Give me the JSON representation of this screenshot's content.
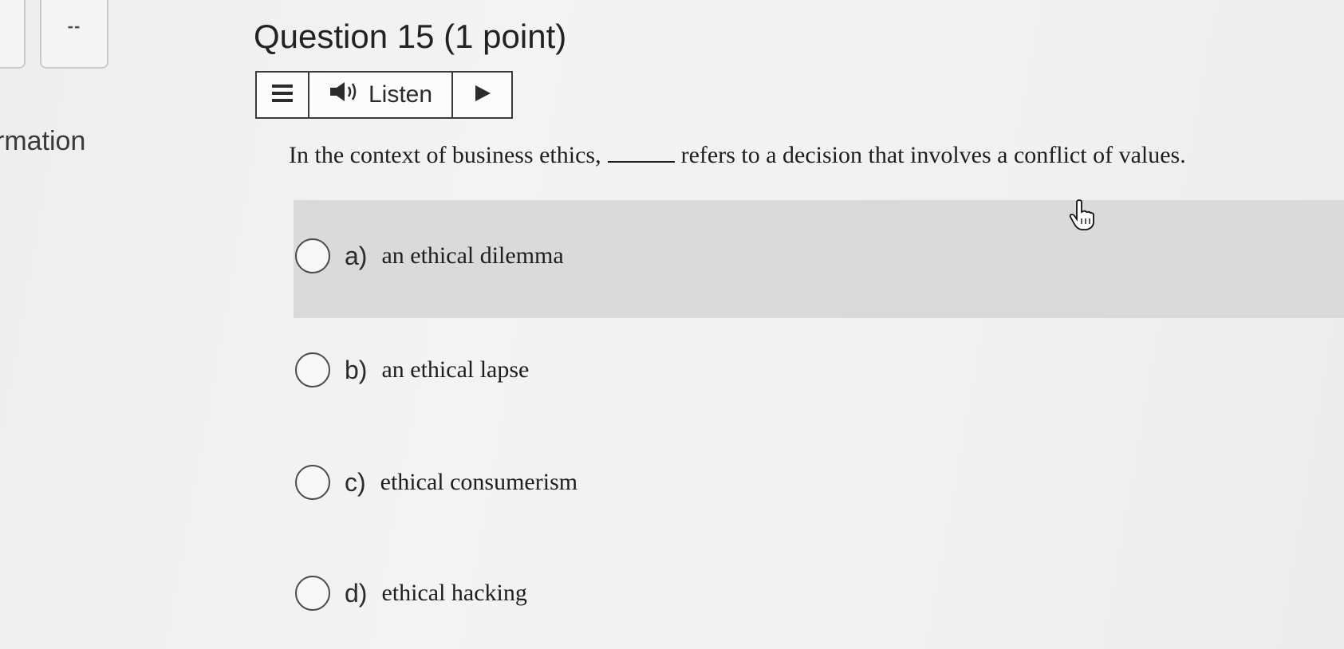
{
  "nav": {
    "box_label": "--",
    "section_label": "rmation"
  },
  "question": {
    "title": "Question 15 (1 point)",
    "stem_before": "In the context of business ethics,",
    "stem_after": "refers to a decision that involves a conflict of values."
  },
  "listen_toolbar": {
    "menu_icon": "hamburger-menu-icon",
    "speaker_icon": "speaker-icon",
    "listen_label": "Listen",
    "play_icon": "play-icon"
  },
  "options": [
    {
      "letter": "a)",
      "text": "an ethical dilemma"
    },
    {
      "letter": "b)",
      "text": "an ethical lapse"
    },
    {
      "letter": "c)",
      "text": "ethical consumerism"
    },
    {
      "letter": "d)",
      "text": "ethical hacking"
    }
  ],
  "cursor": {
    "icon": "hand-pointer-icon"
  },
  "colors": {
    "hover_row": "#dadada",
    "background": "#f1f1f1",
    "border": "#3b3b3b"
  }
}
